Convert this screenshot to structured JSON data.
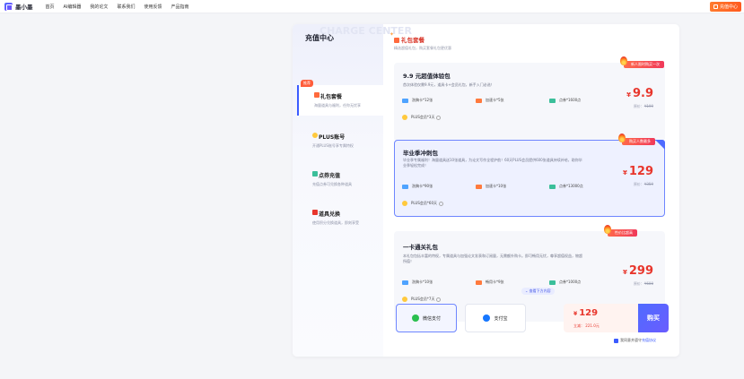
{
  "app": {
    "name": "墨小墨"
  },
  "nav": {
    "items": [
      "首页",
      "AI编辑器",
      "我的论文",
      "联系我们",
      "使用反馈",
      "产品指南"
    ],
    "recharge": "充值中心"
  },
  "sidebar": {
    "title": "充值中心",
    "ghost": "CHARGE CENTER",
    "recommend_tag": "推荐",
    "items": [
      {
        "name": "礼包套餐",
        "sub": "海量道具与福利，任你无忧享"
      },
      {
        "name": "PLUS账号",
        "sub": "开通PLUS账号享专属特权"
      },
      {
        "name": "点券充值",
        "sub": "充值点券可兑换各种道具"
      },
      {
        "name": "道具兑换",
        "sub": "使用积分兑换道具，即刻享受"
      }
    ]
  },
  "main": {
    "title": "礼包套餐",
    "subtitle": "精选超值礼包，购买套餐礼包更优惠"
  },
  "packages": [
    {
      "ribbon": "新人限时购买一次",
      "name": "9.9 元超值体验包",
      "desc": "首次体验仅需9.9元，道具卡+会员礼包，新手入门必选！",
      "features": [
        "洗稿卡*12张",
        "加速卡*5张",
        "点券*1600点",
        "PLUS会员*3天"
      ],
      "price": "9.9",
      "orig_label": "原价：",
      "orig": "¥199"
    },
    {
      "ribbon": "购买人数最多",
      "name": "毕业季冲刺包",
      "desc": "毕业季专属福利！海量道具送10张道具，为论文写作全程护航！60天PLUS会员提供600张道具持续补给，助你毕业季轻松完成！",
      "features": [
        "洗稿卡*90张",
        "加速卡*10张",
        "点券*13000点",
        "PLUS会员*60天"
      ],
      "price": "129",
      "orig_label": "原价：",
      "orig": "¥359"
    },
    {
      "ribbon": "性价比超高",
      "name": "一卡通关礼包",
      "desc": "本礼包包括丰富的特权，专属道具与加强论文发表和订阅量，无需额外购卡。即可畅用无忧，尊享超值权益，物超所值！",
      "features": [
        "洗稿卡*10张",
        "畅用卡*9张",
        "点券*1000点",
        "PLUS会员*7天"
      ],
      "more": "查看下方内容",
      "price": "299",
      "orig_label": "原价：",
      "orig": "¥600"
    }
  ],
  "payment": {
    "wechat": "微信支付",
    "alipay": "支付宝",
    "total": "129",
    "save_label": "立减：",
    "save": "221.0元",
    "buy": "购买",
    "agree_prefix": "我同意并遵守",
    "agree_link": "充值协议"
  },
  "colors": {
    "accent": "#4f6bff",
    "price": "#e8362c",
    "brand_orange": "#ff6a2a"
  }
}
